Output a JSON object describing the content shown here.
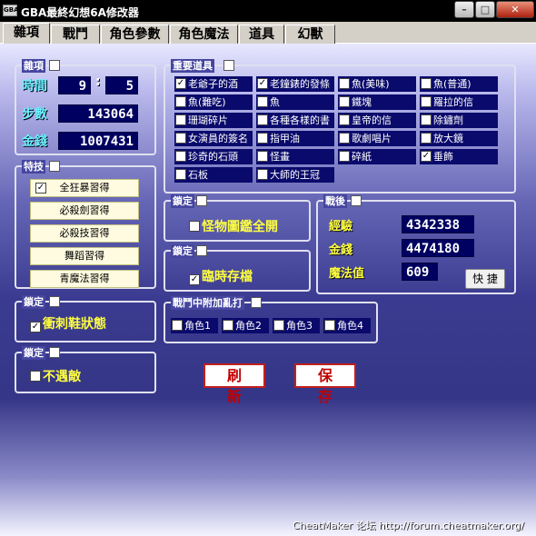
{
  "window": {
    "title": "GBA最終幻想6A修改器",
    "icon_text": "GBA",
    "minimize": "–",
    "maximize": "□",
    "close": "✕"
  },
  "tabs": [
    {
      "label": "雜項",
      "active": true
    },
    {
      "label": "戰鬥",
      "active": false
    },
    {
      "label": "角色參數",
      "active": false
    },
    {
      "label": "角色魔法",
      "active": false
    },
    {
      "label": "道具",
      "active": false
    },
    {
      "label": "幻獸",
      "active": false
    }
  ],
  "misc": {
    "legend": "雜項",
    "time_label": "時間",
    "time_hours": "9",
    "time_sep": ":",
    "time_minutes": "5",
    "steps_label": "步數",
    "steps_value": "143064",
    "gold_label": "金錢",
    "gold_value": "1007431"
  },
  "skills": {
    "legend": "特技",
    "items": [
      {
        "label": "全狂暴習得",
        "checked": true
      },
      {
        "label": "必殺劍習得",
        "checked": false
      },
      {
        "label": "必殺技習得",
        "checked": false
      },
      {
        "label": "舞蹈習得",
        "checked": false
      },
      {
        "label": "青魔法習得",
        "checked": false
      }
    ]
  },
  "lock_boots": {
    "legend": "鎖定",
    "label": "衝刺鞋狀態",
    "checked": true
  },
  "lock_noenc": {
    "legend": "鎖定",
    "label": "不遇敵",
    "checked": false
  },
  "key_items": {
    "legend": "重要道具",
    "items": [
      {
        "label": "老爺子的酒",
        "checked": true
      },
      {
        "label": "老鐘錶的發條",
        "checked": true
      },
      {
        "label": "魚(美味)",
        "checked": false
      },
      {
        "label": "魚(普通)",
        "checked": false
      },
      {
        "label": "魚(難吃)",
        "checked": false
      },
      {
        "label": "魚",
        "checked": false
      },
      {
        "label": "鐵塊",
        "checked": false
      },
      {
        "label": "羅拉的信",
        "checked": false
      },
      {
        "label": "珊瑚碎片",
        "checked": false
      },
      {
        "label": "各種各樣的書",
        "checked": false
      },
      {
        "label": "皇帝的信",
        "checked": false
      },
      {
        "label": "除鏽劑",
        "checked": false
      },
      {
        "label": "女演員的簽名",
        "checked": false
      },
      {
        "label": "指甲油",
        "checked": false
      },
      {
        "label": "歌劇唱片",
        "checked": false
      },
      {
        "label": "放大鏡",
        "checked": false
      },
      {
        "label": "珍奇的石頭",
        "checked": false
      },
      {
        "label": "怪畫",
        "checked": false
      },
      {
        "label": "碎紙",
        "checked": false
      },
      {
        "label": "垂飾",
        "checked": true
      },
      {
        "label": "石板",
        "checked": false
      },
      {
        "label": "大師的王冠",
        "checked": false
      }
    ]
  },
  "lock_monster": {
    "legend": "鎖定",
    "label": "怪物圖鑑全開",
    "checked": false
  },
  "lock_save": {
    "legend": "鎖定",
    "label": "臨時存檔",
    "checked": true
  },
  "battle_flee": {
    "legend": "戰鬥中附加亂打",
    "items": [
      {
        "label": "角色1",
        "checked": false
      },
      {
        "label": "角色2",
        "checked": false
      },
      {
        "label": "角色3",
        "checked": false
      },
      {
        "label": "角色4",
        "checked": false
      }
    ]
  },
  "post_battle": {
    "legend": "戰後",
    "exp_label": "經驗",
    "exp_value": "4342338",
    "gold_label": "金錢",
    "gold_value": "4474180",
    "mp_label": "魔法值",
    "mp_value": "609",
    "quick_button": "快 捷"
  },
  "actions": {
    "refresh": "刷 新",
    "save": "保 存"
  },
  "footer": {
    "text": "CheatMaker 论坛 http://forum.cheatmaker.org/"
  },
  "colors": {
    "accent_label": "#6cf0ff",
    "check_label": "#ffff40",
    "button_text": "#c00000"
  }
}
